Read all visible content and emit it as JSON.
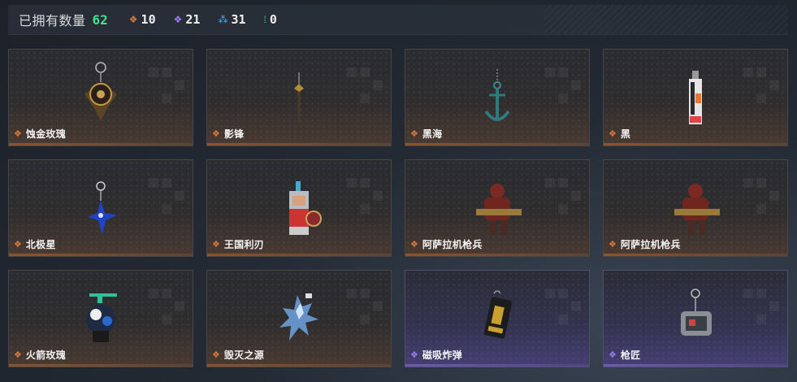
{
  "header": {
    "owned_label": "已拥有数量",
    "owned_count": "62",
    "stats": [
      {
        "icon": "orange-gem-icon",
        "value": "10"
      },
      {
        "icon": "purple-gem-icon",
        "value": "21"
      },
      {
        "icon": "blue-gem-icon",
        "value": "31"
      },
      {
        "icon": "green-gem-icon",
        "value": "0"
      }
    ]
  },
  "colors": {
    "accent_green": "#3fe28c",
    "tier_orange": "#e07a3c",
    "tier_purple": "#9b7cf0",
    "tier_blue": "#4aa8f0",
    "tier_green": "#36d39a"
  },
  "items": [
    {
      "name": "蚀金玫瑰",
      "tier": "orange",
      "icon": "gold-rose-charm-icon"
    },
    {
      "name": "影锋",
      "tier": "orange",
      "icon": "shadow-blade-charm-icon"
    },
    {
      "name": "黑海",
      "tier": "orange",
      "icon": "anchor-charm-icon"
    },
    {
      "name": "黑",
      "tier": "orange",
      "icon": "tag-charm-icon"
    },
    {
      "name": "北极星",
      "tier": "orange",
      "icon": "polaris-charm-icon"
    },
    {
      "name": "王国利刃",
      "tier": "orange",
      "icon": "knight-figure-icon"
    },
    {
      "name": "阿萨拉机枪兵",
      "tier": "orange",
      "icon": "gunner-figure-icon"
    },
    {
      "name": "阿萨拉机枪兵",
      "tier": "orange",
      "icon": "gunner-figure-icon"
    },
    {
      "name": "火箭玫瑰",
      "tier": "orange",
      "icon": "rocket-rose-charm-icon"
    },
    {
      "name": "毁灭之源",
      "tier": "orange",
      "icon": "crystal-dragon-icon"
    },
    {
      "name": "磁吸炸弹",
      "tier": "purple",
      "icon": "magnetic-bomb-charm-icon"
    },
    {
      "name": "枪匠",
      "tier": "purple",
      "icon": "dog-tag-charm-icon"
    }
  ]
}
